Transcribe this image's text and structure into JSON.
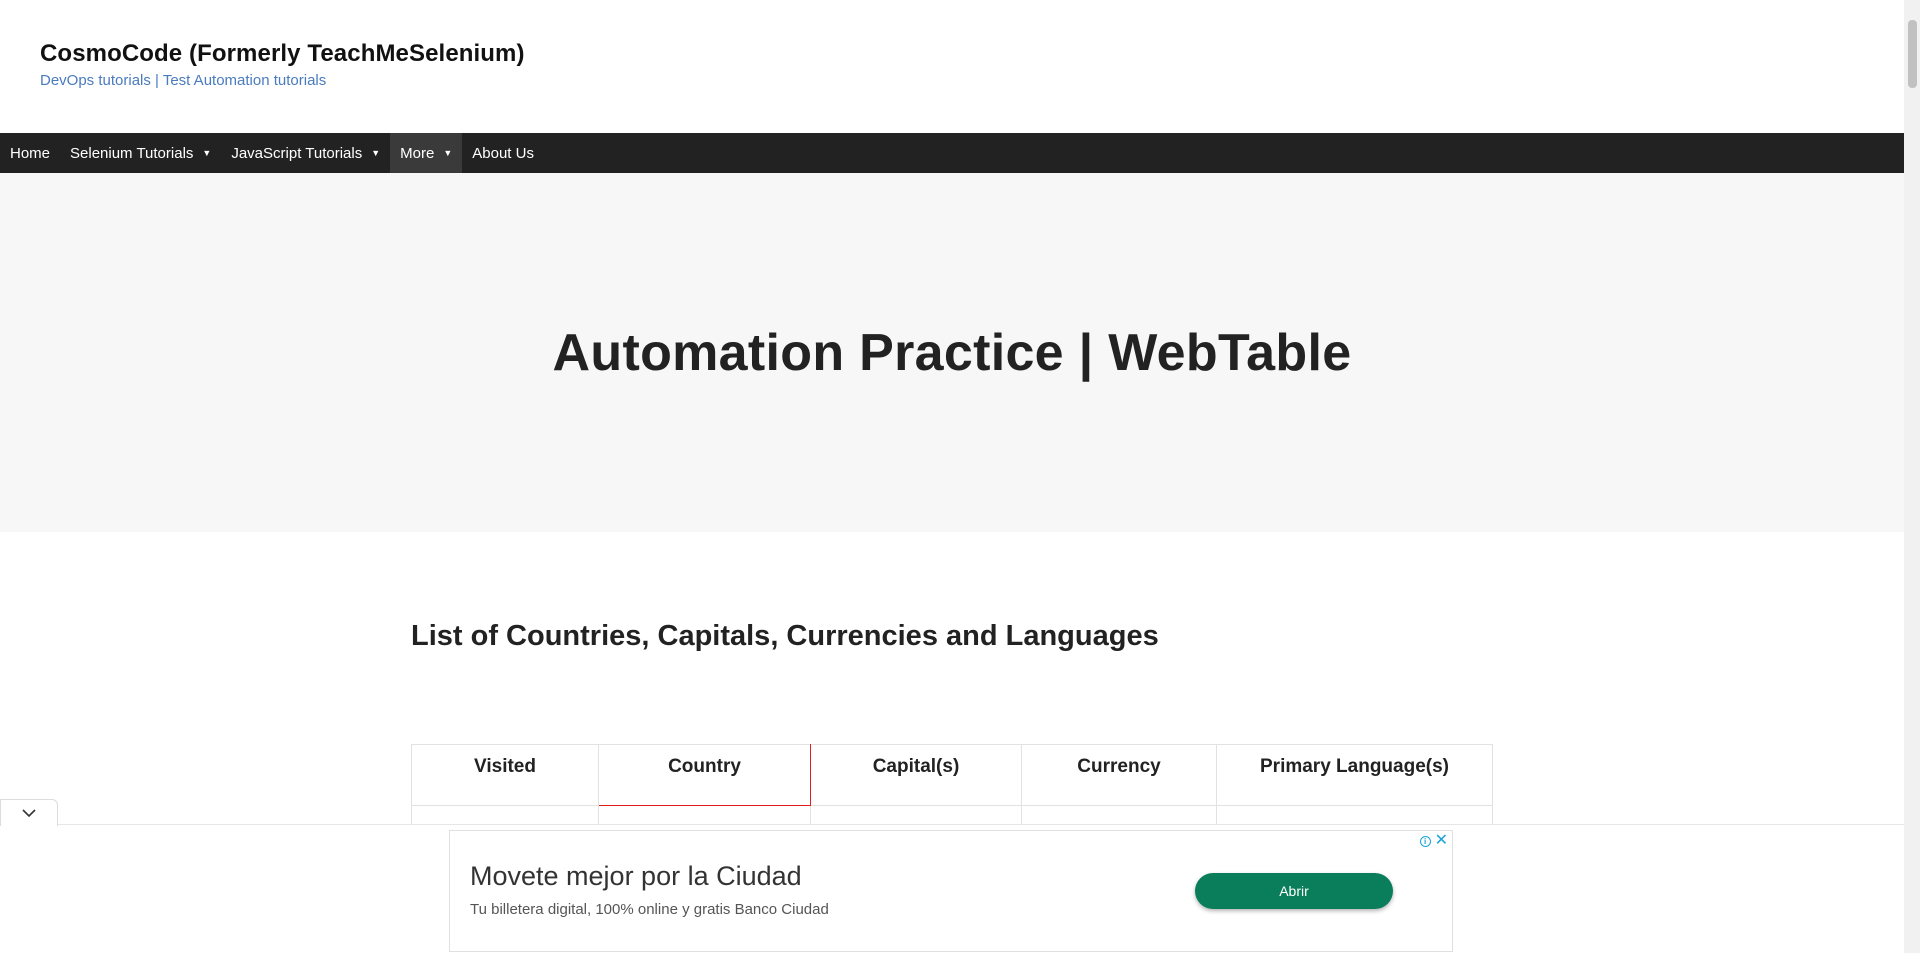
{
  "header": {
    "site_title": "CosmoCode (Formerly TeachMeSelenium)",
    "tagline": "DevOps tutorials | Test Automation tutorials"
  },
  "nav": {
    "items": [
      {
        "label": "Home"
      },
      {
        "label": "Selenium Tutorials"
      },
      {
        "label": "JavaScript Tutorials"
      },
      {
        "label": "More"
      },
      {
        "label": "About Us"
      }
    ],
    "active": "More"
  },
  "hero": {
    "title": "Automation Practice | WebTable"
  },
  "content": {
    "section_heading": "List of Countries, Capitals, Currencies and Languages",
    "table": {
      "headers": [
        "Visited",
        "Country",
        "Capital(s)",
        "Currency",
        "Primary Language(s)"
      ]
    }
  },
  "ad": {
    "headline": "Movete mejor por la Ciudad",
    "body": "Tu billetera digital, 100% online y gratis Banco Ciudad",
    "button_label": "Abrir",
    "button_color": "#0a7d5a"
  },
  "colors": {
    "nav_background": "#222222",
    "tagline": "#4a7bbf",
    "highlight_border": "#e11d1d"
  }
}
